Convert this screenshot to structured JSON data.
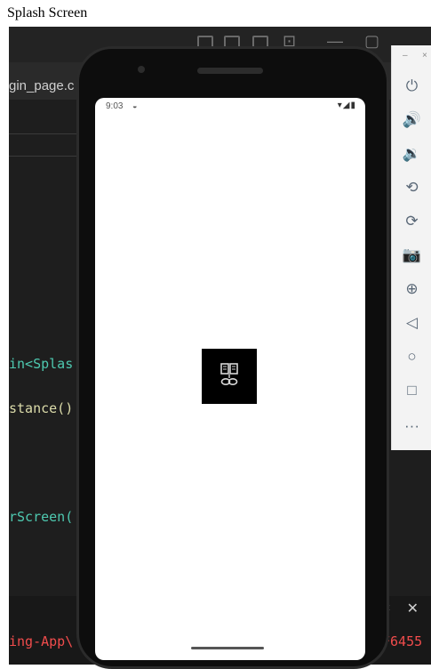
{
  "caption": "Splash Screen",
  "ide": {
    "tab_text": "gin_page.c",
    "code_lines": [
      {
        "text": "in<Splas",
        "color": "#4ec9b0"
      },
      {
        "text": "stance()",
        "color": "#dcdcaa"
      },
      {
        "text": "rScreen(",
        "color": "#4ec9b0"
      }
    ],
    "error_left": "ing-App\\",
    "error_right": "F6455"
  },
  "emulator_toolbar": {
    "icons": [
      "power-icon",
      "volume-up-icon",
      "volume-down-icon",
      "rotate-left-icon",
      "rotate-right-icon",
      "camera-icon",
      "zoom-icon",
      "back-icon",
      "home-icon",
      "overview-icon",
      "more-icon"
    ],
    "glyphs": [
      "⏻",
      "🔊",
      "🔉",
      "⟲",
      "⟳",
      "📷",
      "⊕",
      "◁",
      "○",
      "□",
      "···"
    ]
  },
  "phone": {
    "status_time": "9:03",
    "status_right": "▾◢▮"
  },
  "colors": {
    "ide_bg": "#1e1e1e",
    "error": "#f14c4c",
    "toolbar_icon": "#5a6877"
  }
}
